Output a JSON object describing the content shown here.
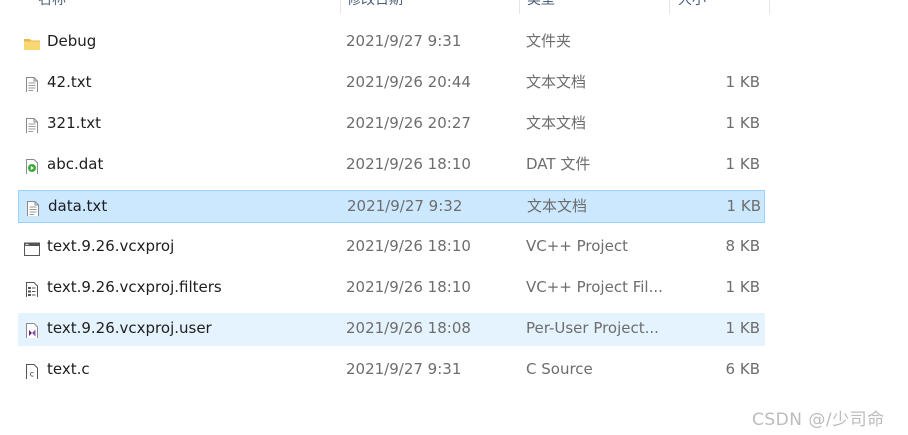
{
  "header": {
    "name": "名称",
    "date_modified": "修改日期",
    "type": "类型",
    "size": "大小"
  },
  "files": [
    {
      "icon": "folder-icon",
      "name": "Debug",
      "date": "2021/9/27 9:31",
      "type": "文件夹",
      "size": ""
    },
    {
      "icon": "text-file-icon",
      "name": "42.txt",
      "date": "2021/9/26 20:44",
      "type": "文本文档",
      "size": "1 KB"
    },
    {
      "icon": "text-file-icon",
      "name": "321.txt",
      "date": "2021/9/26 20:27",
      "type": "文本文档",
      "size": "1 KB"
    },
    {
      "icon": "media-file-icon",
      "name": "abc.dat",
      "date": "2021/9/26 18:10",
      "type": "DAT 文件",
      "size": "1 KB"
    },
    {
      "icon": "text-file-icon",
      "name": "data.txt",
      "date": "2021/9/27 9:32",
      "type": "文本文档",
      "size": "1 KB"
    },
    {
      "icon": "vcxproj-file-icon",
      "name": "text.9.26.vcxproj",
      "date": "2021/9/26 18:10",
      "type": "VC++ Project",
      "size": "8 KB"
    },
    {
      "icon": "filters-file-icon",
      "name": "text.9.26.vcxproj.filters",
      "date": "2021/9/26 18:10",
      "type": "VC++ Project Fil...",
      "size": "1 KB"
    },
    {
      "icon": "vs-user-file-icon",
      "name": "text.9.26.vcxproj.user",
      "date": "2021/9/26 18:08",
      "type": "Per-User Project...",
      "size": "1 KB"
    },
    {
      "icon": "c-source-file-icon",
      "name": "text.c",
      "date": "2021/9/27 9:31",
      "type": "C Source",
      "size": "6 KB"
    }
  ],
  "selected_index": 4,
  "hover_index": 7,
  "colors": {
    "selected_bg": "#cce8ff",
    "selected_border": "#99d1ff",
    "hover_bg": "#e5f3ff",
    "folder": "#f8d775"
  },
  "watermark": "CSDN @/少司命"
}
